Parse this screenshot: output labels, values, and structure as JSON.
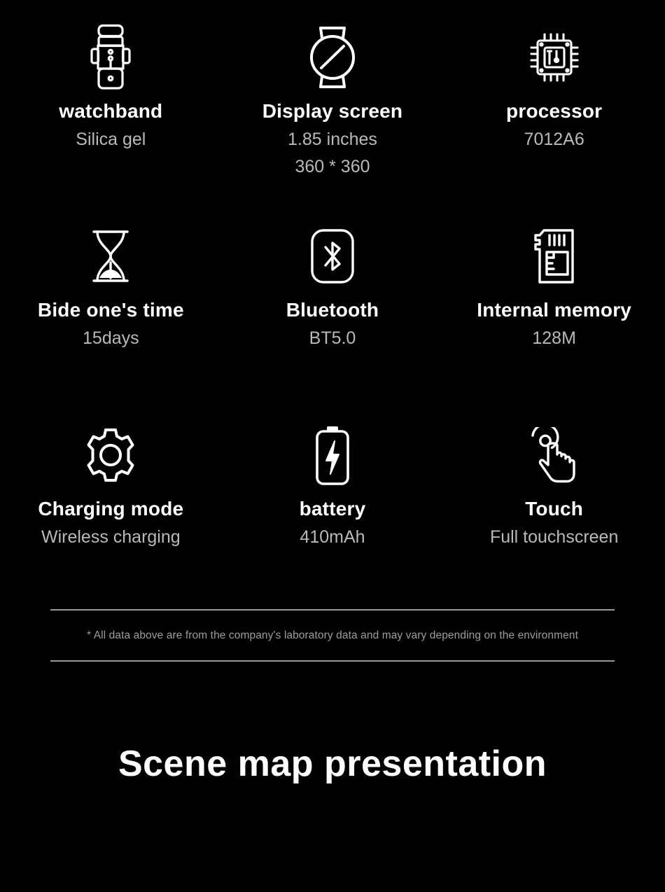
{
  "page": {
    "background_color": "#000000",
    "title_color": "#ffffff",
    "value_color": "#b9b9b9",
    "rule_color": "#9a9a9a"
  },
  "specs": [
    {
      "icon": "watchband-icon",
      "title": "watchband",
      "values": [
        "Silica gel"
      ]
    },
    {
      "icon": "watch-display-icon",
      "title": "Display screen",
      "values": [
        "1.85 inches",
        "360 * 360"
      ]
    },
    {
      "icon": "processor-chip-icon",
      "title": "processor",
      "values": [
        "7012A6"
      ]
    },
    {
      "icon": "hourglass-icon",
      "title": "Bide one's time",
      "values": [
        "15days"
      ]
    },
    {
      "icon": "bluetooth-icon",
      "title": "Bluetooth",
      "values": [
        "BT5.0"
      ]
    },
    {
      "icon": "memory-card-icon",
      "title": "Internal memory",
      "values": [
        "128M"
      ]
    },
    {
      "icon": "gear-icon",
      "title": "Charging mode",
      "values": [
        "Wireless charging"
      ]
    },
    {
      "icon": "battery-charging-icon",
      "title": "battery",
      "values": [
        "410mAh"
      ]
    },
    {
      "icon": "touch-hand-icon",
      "title": "Touch",
      "values": [
        "Full touchscreen"
      ]
    }
  ],
  "note": {
    "text": "* All data above are from the company's laboratory data and may vary depending on the environment"
  },
  "bottom_heading": {
    "text": "Scene map presentation"
  }
}
